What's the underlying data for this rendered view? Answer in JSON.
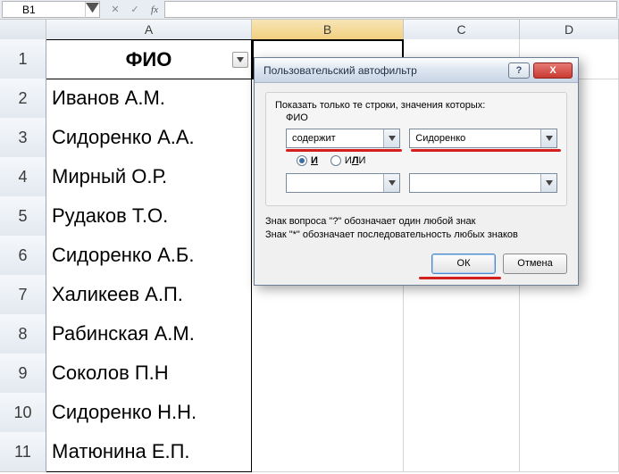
{
  "formula_bar": {
    "name_box": "B1",
    "fx_label": "fx",
    "formula_value": ""
  },
  "columns": [
    "A",
    "B",
    "C",
    "D"
  ],
  "selected_column": "B",
  "selected_cell": "B1",
  "rows": [
    {
      "num": 1,
      "A": "ФИО"
    },
    {
      "num": 2,
      "A": "Иванов А.М."
    },
    {
      "num": 3,
      "A": "Сидоренко А.А."
    },
    {
      "num": 4,
      "A": "Мирный О.Р."
    },
    {
      "num": 5,
      "A": "Рудаков Т.О."
    },
    {
      "num": 6,
      "A": "Сидоренко А.Б."
    },
    {
      "num": 7,
      "A": "Халикеев А.П."
    },
    {
      "num": 8,
      "A": "Рабинская А.М."
    },
    {
      "num": 9,
      "A": "Соколов П.Н"
    },
    {
      "num": 10,
      "A": "Сидоренко Н.Н."
    },
    {
      "num": 11,
      "A": "Матюнина Е.П."
    }
  ],
  "dialog": {
    "title": "Пользовательский автофильтр",
    "group_title": "Показать только те строки, значения которых:",
    "field": "ФИО",
    "condition1": {
      "op": "содержит",
      "value": "Сидоренко"
    },
    "logic": {
      "and": "И",
      "or": "ИЛИ",
      "selected": "and"
    },
    "condition2": {
      "op": "",
      "value": ""
    },
    "hint1": "Знак вопроса \"?\" обозначает один любой знак",
    "hint2": "Знак \"*\" обозначает последовательность любых знаков",
    "ok": "ОК",
    "cancel": "Отмена",
    "help": "?",
    "close": "X"
  }
}
